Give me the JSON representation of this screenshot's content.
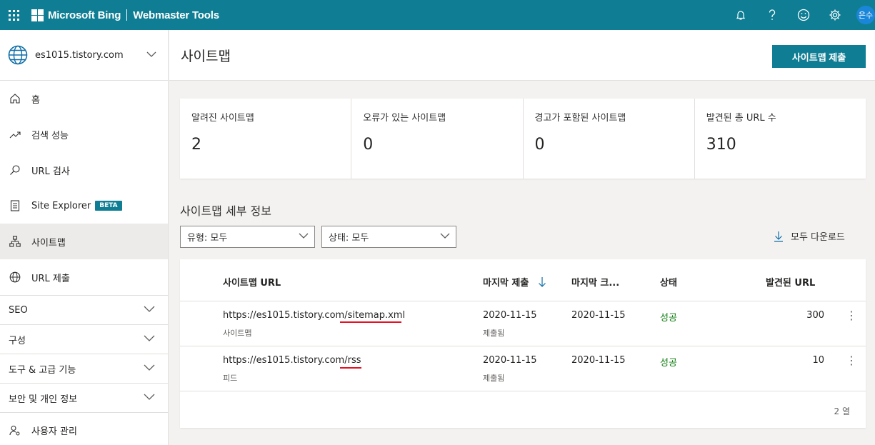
{
  "topbar": {
    "brand": "Microsoft Bing",
    "product": "Webmaster Tools",
    "icons": [
      "waffle-icon",
      "bell-icon",
      "help-icon",
      "smiley-icon",
      "gear-icon"
    ],
    "avatar_text": "은수"
  },
  "sidebar": {
    "site": "es1015.tistory.com",
    "items": [
      {
        "label": "홈",
        "icon": "home-icon"
      },
      {
        "label": "검색 성능",
        "icon": "trend-icon"
      },
      {
        "label": "URL 검사",
        "icon": "search-icon"
      },
      {
        "label": "Site Explorer",
        "icon": "document-icon",
        "badge": "BETA"
      },
      {
        "label": "사이트맵",
        "icon": "sitemap-icon",
        "active": true
      },
      {
        "label": "URL 제출",
        "icon": "globe-icon"
      }
    ],
    "groups": [
      {
        "label": "SEO"
      },
      {
        "label": "구성"
      },
      {
        "label": "도구 & 고급 기능"
      },
      {
        "label": "보안 및 개인 정보"
      }
    ],
    "bottom_item": {
      "label": "사용자 관리",
      "icon": "user-settings-icon"
    }
  },
  "header": {
    "title": "사이트맵",
    "submit_label": "사이트맵 제출"
  },
  "stats": [
    {
      "label": "알려진 사이트맵",
      "value": "2"
    },
    {
      "label": "오류가 있는 사이트맵",
      "value": "0"
    },
    {
      "label": "경고가 포함된 사이트맵",
      "value": "0"
    },
    {
      "label": "발견된 총 URL 수",
      "value": "310"
    }
  ],
  "details": {
    "title": "사이트맵 세부 정보",
    "filter_type": "유형: 모두",
    "filter_status": "상태: 모두",
    "download_label": "모두 다운로드"
  },
  "table": {
    "columns": [
      "사이트맵 URL",
      "마지막 제출",
      "마지막 크...",
      "상태",
      "발견된 URL"
    ],
    "rows": [
      {
        "url_base": "https://es1015.tistory.com/",
        "url_path": "sitemap.xml",
        "kind": "사이트맵",
        "last_submitted": "2020-11-15",
        "submitted_note": "제출됨",
        "last_crawled": "2020-11-15",
        "status": "성공",
        "discovered": "300"
      },
      {
        "url_base": "https://es1015.tistory.com/",
        "url_path": "rss",
        "kind": "피드",
        "last_submitted": "2020-11-15",
        "submitted_note": "제출됨",
        "last_crawled": "2020-11-15",
        "status": "성공",
        "discovered": "10"
      }
    ],
    "row_count": "2 열"
  },
  "colors": {
    "accent": "#0f7e94",
    "success": "#107c10",
    "annotation": "#e81123"
  }
}
